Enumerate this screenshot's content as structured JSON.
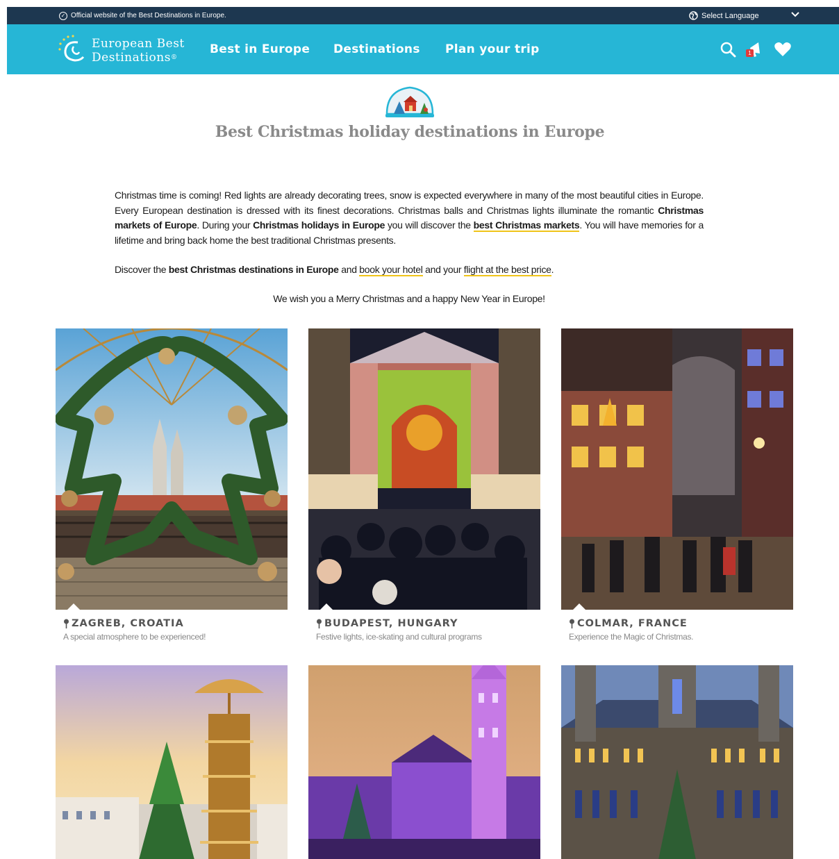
{
  "topbar": {
    "official_text": "Official website of the Best Destinations in Europe.",
    "language_label": "Select Language"
  },
  "brand": {
    "name_line1": "European Best",
    "name_line2": "Destinations",
    "registered": "®"
  },
  "nav": {
    "items": [
      {
        "label": "Best in Europe"
      },
      {
        "label": "Destinations"
      },
      {
        "label": "Plan your trip"
      }
    ],
    "search_icon": "search-icon",
    "notification_badge": "1",
    "favorites_icon": "heart-icon"
  },
  "page": {
    "title": "Best Christmas holiday destinations in Europe",
    "intro_1_a": "Christmas time is coming! Red lights are already decorating trees, snow is expected everywhere in many of the most beautiful cities in Europe. Every European destination is dressed with its finest decorations. Christmas balls and Christmas lights illuminate the romantic ",
    "intro_1_b": "Christmas markets of Europe",
    "intro_1_c": ". During your ",
    "intro_1_d": "Christmas holidays in Europe",
    "intro_1_e": " you will discover the ",
    "intro_1_link": "best Christmas markets",
    "intro_1_f": ". You will have memories for a lifetime and bring back home the best traditional Christmas presents.",
    "intro_2_a": "Discover the ",
    "intro_2_b": "best Christmas destinations in Europe",
    "intro_2_c": " and ",
    "intro_2_link1": "book your hotel",
    "intro_2_d": " and your ",
    "intro_2_link2": "flight at the best price",
    "intro_2_e": ".",
    "wish": "We wish you a Merry Christmas and a happy New Year in Europe!"
  },
  "destinations": [
    {
      "place": "ZAGREB, CROATIA",
      "tagline": "A special atmosphere to be experienced!"
    },
    {
      "place": "BUDAPEST, HUNGARY",
      "tagline": "Festive lights, ice-skating and cultural programs"
    },
    {
      "place": "COLMAR, FRANCE",
      "tagline": "Experience the Magic of Christmas."
    },
    {
      "place": "",
      "tagline": ""
    },
    {
      "place": "",
      "tagline": ""
    },
    {
      "place": "",
      "tagline": ""
    }
  ],
  "colors": {
    "topbar": "#1d3750",
    "navbar": "#26b6d6",
    "link_underline": "#f0c419",
    "title": "#8a8a8a"
  }
}
